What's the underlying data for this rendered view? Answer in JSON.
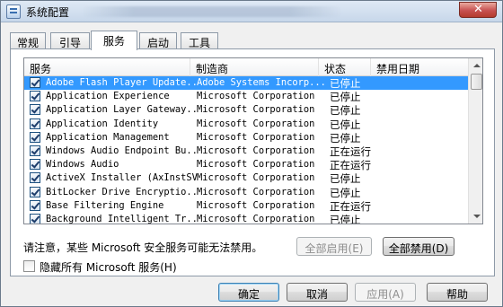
{
  "window": {
    "title": "系统配置"
  },
  "tabs": [
    {
      "label": "常规"
    },
    {
      "label": "引导"
    },
    {
      "label": "服务"
    },
    {
      "label": "启动"
    },
    {
      "label": "工具"
    }
  ],
  "active_tab": "服务",
  "list": {
    "columns": [
      "服务",
      "制造商",
      "状态",
      "禁用日期"
    ],
    "rows": [
      {
        "service": "Adobe Flash Player Update...",
        "manufacturer": "Adobe Systems Incorp...",
        "status": "已停止",
        "checked": true,
        "selected": true
      },
      {
        "service": "Application Experience",
        "manufacturer": "Microsoft Corporation",
        "status": "已停止",
        "checked": true
      },
      {
        "service": "Application Layer Gateway...",
        "manufacturer": "Microsoft Corporation",
        "status": "已停止",
        "checked": true
      },
      {
        "service": "Application Identity",
        "manufacturer": "Microsoft Corporation",
        "status": "已停止",
        "checked": true
      },
      {
        "service": "Application Management",
        "manufacturer": "Microsoft Corporation",
        "status": "已停止",
        "checked": true
      },
      {
        "service": "Windows Audio Endpoint Bu...",
        "manufacturer": "Microsoft Corporation",
        "status": "正在运行",
        "checked": true
      },
      {
        "service": "Windows Audio",
        "manufacturer": "Microsoft Corporation",
        "status": "正在运行",
        "checked": true
      },
      {
        "service": "ActiveX Installer (AxInstSV)",
        "manufacturer": "Microsoft Corporation",
        "status": "已停止",
        "checked": true
      },
      {
        "service": "BitLocker Drive Encryptio...",
        "manufacturer": "Microsoft Corporation",
        "status": "已停止",
        "checked": true
      },
      {
        "service": "Base Filtering Engine",
        "manufacturer": "Microsoft Corporation",
        "status": "正在运行",
        "checked": true
      },
      {
        "service": "Background Intelligent Tr...",
        "manufacturer": "Microsoft Corporation",
        "status": "已停止",
        "checked": true
      }
    ]
  },
  "note": "请注意，某些 Microsoft 安全服务可能无法禁用。",
  "buttons": {
    "enable_all": "全部启用(E)",
    "disable_all": "全部禁用(D)",
    "ok": "确定",
    "cancel": "取消",
    "apply": "应用(A)",
    "help": "帮助"
  },
  "hide_ms_label": "隐藏所有 Microsoft 服务(H)",
  "hide_ms_checked": false,
  "colors": {
    "selection": "#3399ff",
    "close_button": "#c75050"
  }
}
